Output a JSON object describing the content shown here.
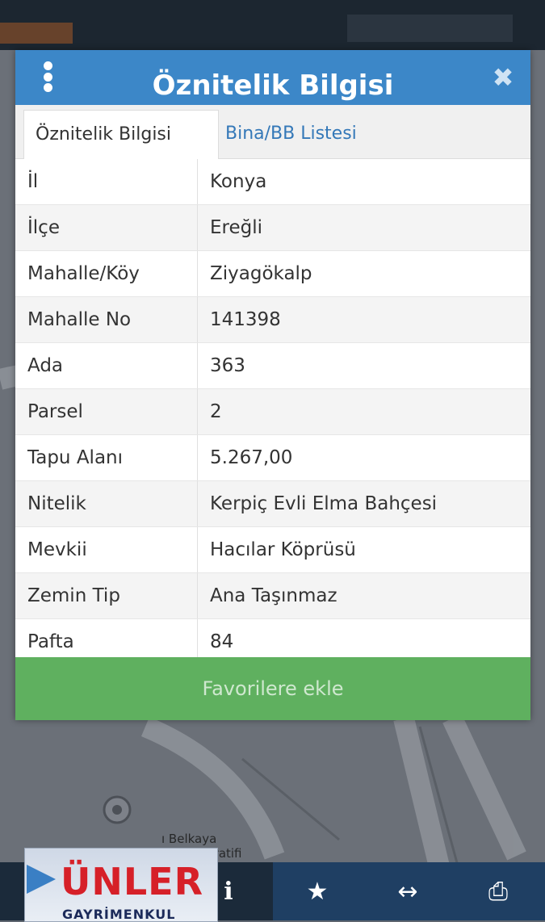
{
  "dialog": {
    "title": "Öznitelik Bilgisi",
    "tabs": [
      {
        "label": "Öznitelik Bilgisi",
        "active": true
      },
      {
        "label": "Bina/BB Listesi",
        "active": false
      }
    ],
    "rows": [
      {
        "key": "İl",
        "value": "Konya"
      },
      {
        "key": "İlçe",
        "value": "Ereğli"
      },
      {
        "key": "Mahalle/Köy",
        "value": "Ziyagökalp"
      },
      {
        "key": "Mahalle No",
        "value": "141398"
      },
      {
        "key": "Ada",
        "value": "363"
      },
      {
        "key": "Parsel",
        "value": "2"
      },
      {
        "key": "Tapu Alanı",
        "value": "5.267,00"
      },
      {
        "key": "Nitelik",
        "value": "Kerpiç Evli Elma Bahçesi"
      },
      {
        "key": "Mevkii",
        "value": "Hacılar Köprüsü"
      },
      {
        "key": "Zemin Tip",
        "value": "Ana Taşınmaz"
      },
      {
        "key": "Pafta",
        "value": "84"
      }
    ],
    "favorite_button": "Favorilere ekle"
  },
  "map": {
    "label_line1": "ı Belkaya",
    "label_line2": "di Kooperatifi"
  },
  "logo": {
    "brand": "ÜNLER",
    "sub": "GAYRİMENKUL"
  },
  "toolbar": {
    "info_icon": "i",
    "star_icon": "★",
    "arrows_icon": "↔",
    "print_icon": "⎙"
  },
  "colors": {
    "header": "#3c87c8",
    "tab_link": "#3478b8",
    "favorite": "#5fb05f",
    "toolbar": "#1f3f63"
  }
}
